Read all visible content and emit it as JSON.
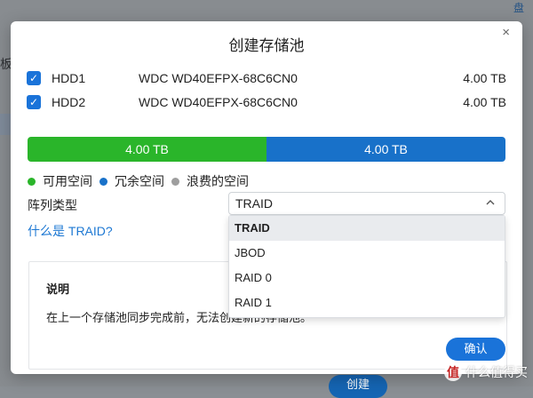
{
  "background": {
    "left_text": "板",
    "topright_text": "盘",
    "create_button": "创建"
  },
  "dialog": {
    "title": "创建存储池",
    "close_icon": "×",
    "disks": [
      {
        "name": "HDD1",
        "model": "WDC WD40EFPX-68C6CN0",
        "size": "4.00 TB",
        "checked": true
      },
      {
        "name": "HDD2",
        "model": "WDC WD40EFPX-68C6CN0",
        "size": "4.00 TB",
        "checked": true
      }
    ],
    "capacity_bar": [
      {
        "label": "4.00 TB",
        "value_tb": 4.0,
        "type": "available",
        "color": "#2ab52a"
      },
      {
        "label": "4.00 TB",
        "value_tb": 4.0,
        "type": "redundant",
        "color": "#1871c9"
      }
    ],
    "legend": [
      {
        "label": "可用空间",
        "color": "#2ab52a"
      },
      {
        "label": "冗余空间",
        "color": "#1871c9"
      },
      {
        "label": "浪费的空间",
        "color": "#9e9e9e"
      }
    ],
    "raid_type_label": "阵列类型",
    "raid_type_value": "TRAID",
    "what_is_link": "什么是 TRAID?",
    "raid_options": [
      "TRAID",
      "JBOD",
      "RAID 0",
      "RAID 1"
    ],
    "description": {
      "title": "说明",
      "text": "在上一个存储池同步完成前，无法创建新的存储池。"
    },
    "confirm_button": "确认"
  },
  "watermark": {
    "logo": "值",
    "text": "什么值得买"
  }
}
